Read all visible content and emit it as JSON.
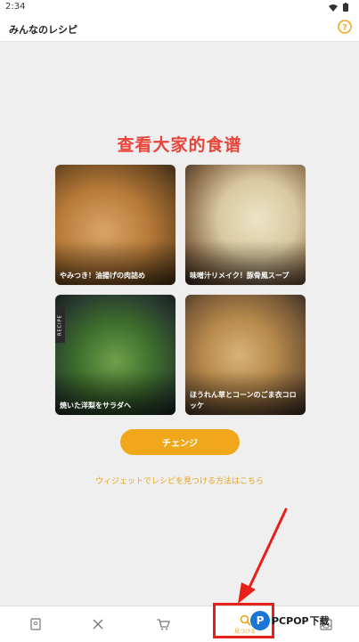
{
  "status_bar": {
    "time": "2:34"
  },
  "app_bar": {
    "title": "みんなのレシピ",
    "help_symbol": "?"
  },
  "headline": "查看大家的食谱",
  "cards": [
    {
      "caption": "やみつき！油揚げの肉詰め"
    },
    {
      "caption": "味噌汁リメイク！豚骨風スープ"
    },
    {
      "caption": "焼いた洋梨をサラダへ",
      "tag": "RECIPE"
    },
    {
      "caption": "ほうれん草とコーンのごま衣コロッケ"
    }
  ],
  "change_button": {
    "label": "チェンジ"
  },
  "widget_link": "ウィジェットでレシピを見つける方法はこちら",
  "bottom_nav": {
    "items": [
      {
        "icon": "recipe-book-icon"
      },
      {
        "icon": "utensils-icon"
      },
      {
        "icon": "cart-icon"
      },
      {
        "icon": "search-icon",
        "label": "見つける"
      },
      {
        "icon": "inbox-icon"
      }
    ]
  },
  "watermark": {
    "logo_letter": "P",
    "text_a": "PCPOP",
    "text_b": "下载"
  },
  "colors": {
    "accent": "#f0a81a",
    "headline": "#e8443a",
    "annotation": "#e8201a",
    "watermark_blue": "#1a75d6"
  }
}
